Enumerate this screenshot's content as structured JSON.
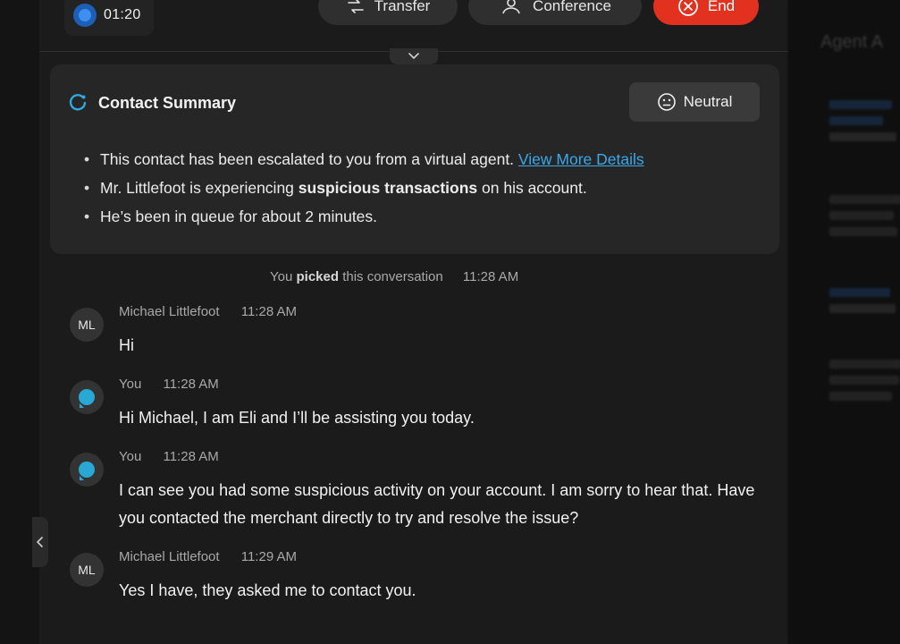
{
  "call": {
    "timer": "01:20",
    "transfer_label": "Transfer",
    "conference_label": "Conference",
    "end_label": "End"
  },
  "summary": {
    "title": "Contact Summary",
    "sentiment": "Neutral",
    "bullet1_text": "This contact has been escalated to you from a virtual agent.",
    "bullet1_link": "View More Details",
    "bullet2_pre": "Mr. Littlefoot is experiencing",
    "bullet2_bold": "suspicious transactions",
    "bullet2_post": "on his account.",
    "bullet3": "He’s been in queue for about 2 minutes."
  },
  "conversation": {
    "system": {
      "pre": "You",
      "bold": "picked",
      "post": "this conversation",
      "time": "11:28 AM"
    },
    "messages": [
      {
        "initials": "ML",
        "sender": "Michael Littlefoot",
        "time": "11:28 AM",
        "text": "Hi"
      },
      {
        "initials": "",
        "sender": "You",
        "time": "11:28 AM",
        "text": "Hi Michael, I am Eli and I’ll be assisting you today."
      },
      {
        "initials": "",
        "sender": "You",
        "time": "11:28 AM",
        "text": "I can see you had some suspicious activity on your account. I am sorry to hear that. Have you contacted the merchant directly to try and resolve the issue?"
      },
      {
        "initials": "ML",
        "sender": "Michael Littlefoot",
        "time": "11:29 AM",
        "text": "Yes I have, they asked me to contact you."
      }
    ]
  },
  "right_panel": {
    "title": "Agent A"
  },
  "icons": {
    "expand": "chevron-down-icon",
    "collapse": "chevron-left-icon",
    "summary": "ai-summary-icon",
    "sentiment": "neutral-face-icon",
    "you_avatar": "chat-bubble-icon"
  },
  "colors": {
    "end_button": "#e2311f",
    "link": "#3aa8ea",
    "you_avatar": "#29a8d6",
    "timer_dot": "#3f8ff0"
  }
}
